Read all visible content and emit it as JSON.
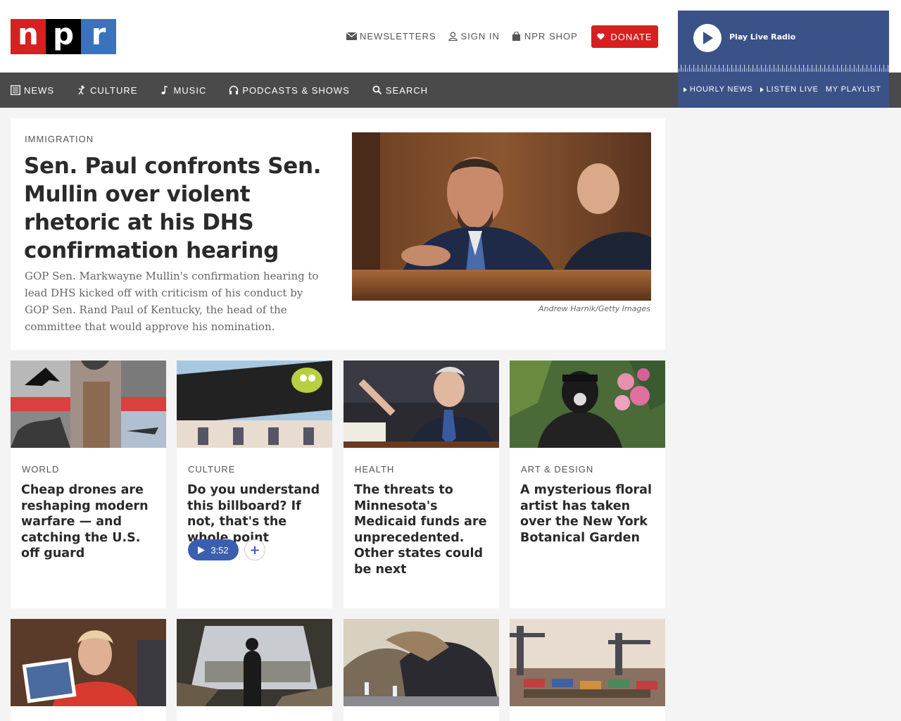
{
  "logo": {
    "letters": [
      "n",
      "p",
      "r"
    ]
  },
  "utility": {
    "newsletters": "NEWSLETTERS",
    "sign_in": "SIGN IN",
    "shop": "NPR SHOP",
    "donate": "DONATE"
  },
  "nav": {
    "items": [
      {
        "label": "NEWS",
        "icon": "news-icon"
      },
      {
        "label": "CULTURE",
        "icon": "culture-icon"
      },
      {
        "label": "MUSIC",
        "icon": "music-note-icon"
      },
      {
        "label": "PODCASTS & SHOWS",
        "icon": "headphones-icon"
      },
      {
        "label": "SEARCH",
        "icon": "search-icon"
      }
    ]
  },
  "player": {
    "play_label": "Play Live Radio",
    "links": [
      "HOURLY NEWS",
      "LISTEN LIVE",
      "MY PLAYLIST"
    ]
  },
  "hero": {
    "kicker": "IMMIGRATION",
    "headline": "Sen. Paul confronts Sen. Mullin over violent rhetoric at his DHS confirmation hearing",
    "teaser": "GOP Sen. Markwayne Mullin's confirmation hearing to lead DHS kicked off with criticism of his conduct by GOP Sen. Rand Paul of Kentucky, the head of the committee that would approve his nomination.",
    "credit": "Andrew Harnik/Getty Images"
  },
  "cards": [
    {
      "kicker": "WORLD",
      "headline": "Cheap drones are reshaping modern warfare — and catching the U.S. off guard"
    },
    {
      "kicker": "CULTURE",
      "headline": "Do you understand this billboard? If not, that's the whole point",
      "audio": "3:52"
    },
    {
      "kicker": "HEALTH",
      "headline": "The threats to Minnesota's Medicaid funds are unprecedented. Other states could be next"
    },
    {
      "kicker": "ART & DESIGN",
      "headline": "A mysterious floral artist has taken over the New York Botanical Garden"
    }
  ],
  "colors": {
    "npr_red": "#d62021",
    "npr_blue": "#3a73bb",
    "nav_bg": "#4a4a4a",
    "player_bg": "#3b5288",
    "audio_blue": "#3b5fb0"
  }
}
